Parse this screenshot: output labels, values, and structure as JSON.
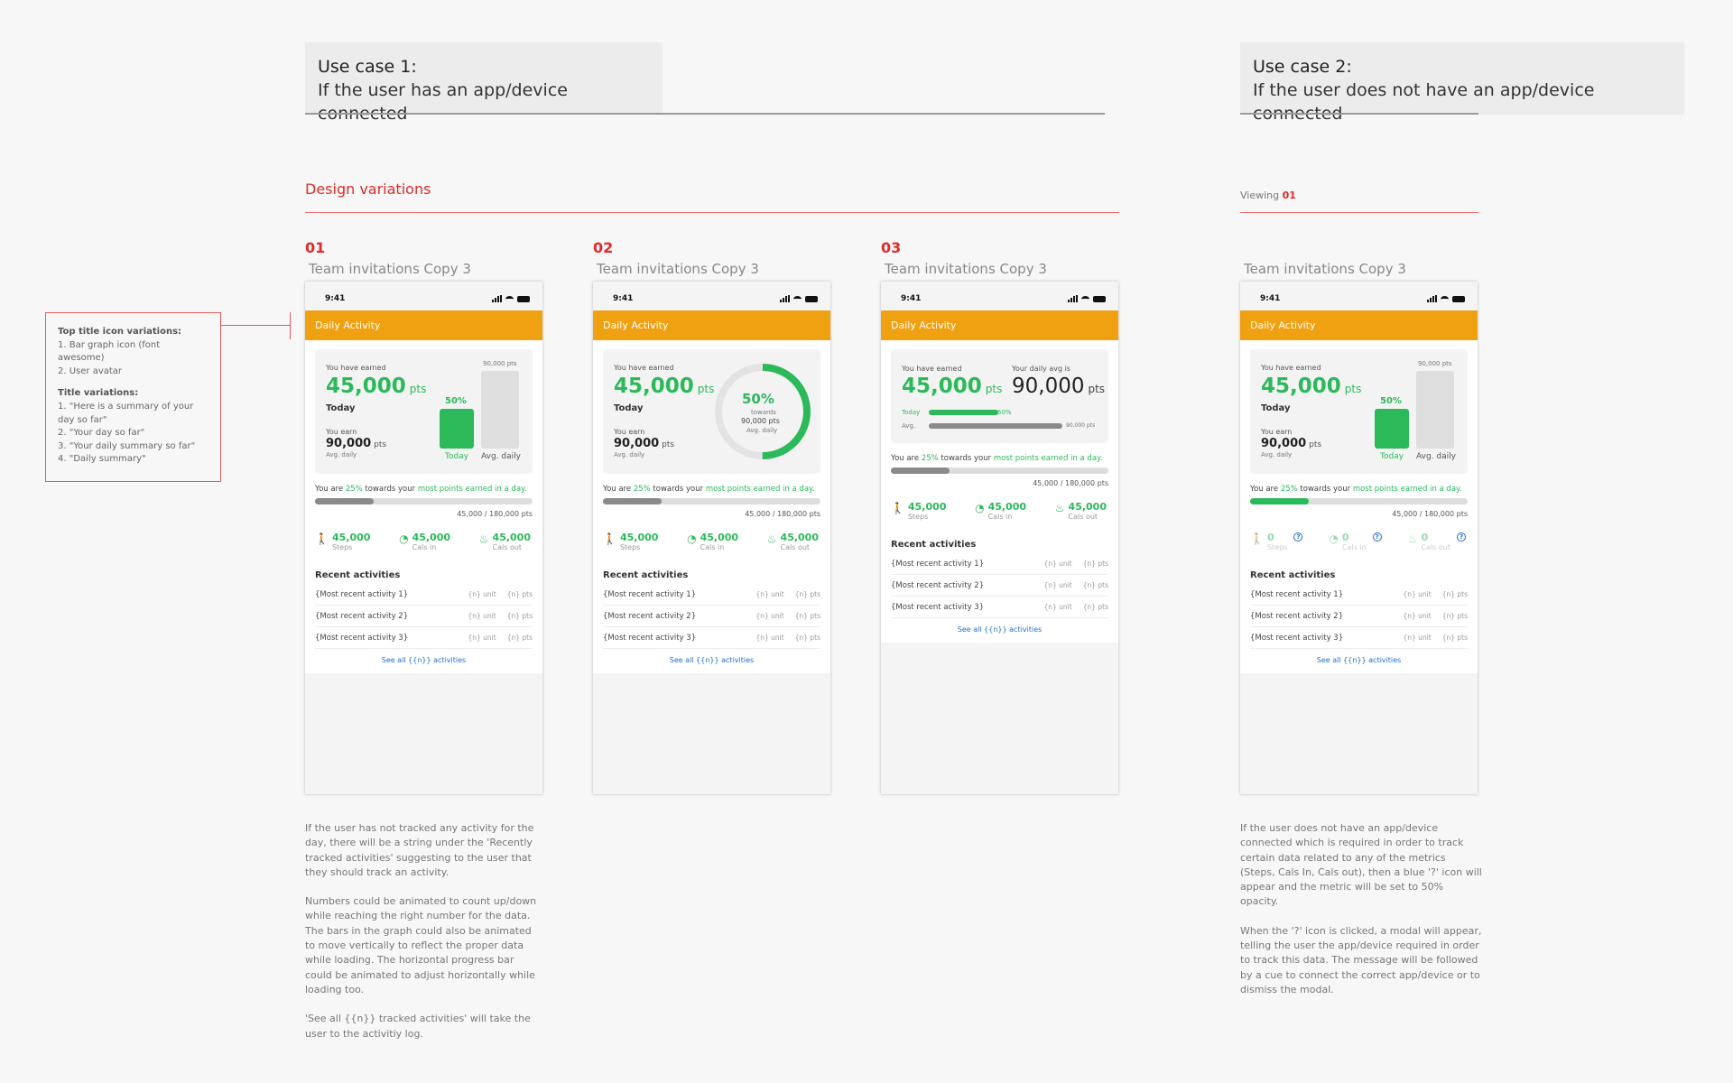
{
  "use_case_1": {
    "title": "Use case 1:",
    "subtitle": "If the user has an app/device connected"
  },
  "use_case_2": {
    "title": "Use case 2:",
    "subtitle": "If the user does not have an app/device connected"
  },
  "design_variations": "Design variations",
  "viewing": {
    "label": "Viewing",
    "value": "01"
  },
  "note": {
    "h1": "Top title icon variations:",
    "l1": "1. Bar graph icon (font awesome)",
    "l2": "2. User avatar",
    "h2": "Title variations:",
    "l3": "1. \"Here is a summary of your",
    "l4": "day so far\"",
    "l5": "2. \"Your day so far\"",
    "l6": "3. \"Your daily summary so far\"",
    "l7": "4. \"Daily summary\""
  },
  "screen": {
    "time": "9:41",
    "appbar": "Daily Activity",
    "you_have_earned": "You have earned",
    "earned_value": "45,000",
    "pts": "pts",
    "today": "Today",
    "you_earn": "You earn",
    "earn_value": "90,000",
    "avg_daily_small": "Avg. daily",
    "bar_top_label": "90,000 pts",
    "pct": "50%",
    "bar_today": "Today",
    "bar_avg": "Avg. daily",
    "goal_pre": "You are ",
    "goal_pct": "25%",
    "goal_mid": " towards your ",
    "goal_link": "most points earned in a day.",
    "goal_value": "45,000 / 180,000 pts",
    "goal_progress": 0.27,
    "steps_value": "45,000",
    "steps_label": "Steps",
    "calsin_value": "45,000",
    "calsin_label": "Cals in",
    "calsout_value": "45,000",
    "calsout_label": "Cals out",
    "zero_value": "0",
    "recent": "Recent activities",
    "activities": [
      {
        "name": "{Most recent activity 1}",
        "unit": "{n} unit",
        "pts": "{n} pts"
      },
      {
        "name": "{Most recent activity 2}",
        "unit": "{n} unit",
        "pts": "{n} pts"
      },
      {
        "name": "{Most recent activity 3}",
        "unit": "{n} unit",
        "pts": "{n} pts"
      }
    ],
    "see_all": "See all {{n}} activities",
    "ring_towards": "towards",
    "ring_value": "90,000 pts",
    "ring_progress": 0.5,
    "daily_avg_label": "Your daily avg is",
    "daily_avg_value": "90,000",
    "hbar_today": "Today",
    "hbar_avg": "Avg.",
    "hbar_today_progress": 0.5,
    "hbar_avg_value": "90,000 pts"
  },
  "variations": [
    {
      "num": "01",
      "title": "Team invitations Copy 3"
    },
    {
      "num": "02",
      "title": "Team invitations Copy 3"
    },
    {
      "num": "03",
      "title": "Team invitations Copy 3"
    },
    {
      "title": "Team invitations Copy 3"
    }
  ],
  "desc1": {
    "p1": "If the user has not tracked any activity for the day, there will be a string under the 'Recently tracked activities' suggesting to the user that they should track an activity.",
    "p2": "Numbers could be animated to count up/down while reaching the right number for the data. The bars in the graph could also be animated to move vertically to reflect the proper data while loading. The horizontal progress bar could be animated to adjust horizontally while loading too.",
    "p3": "'See all {{n}} tracked activities' will take the user to the activitiy log."
  },
  "desc2": {
    "p1": "If the user does not have an app/device connected which is required in order to track certain data related to any of the metrics (Steps, Cals In, Cals out), then a blue '?' icon will appear and the metric will be set to 50% opacity.",
    "p2": "When the '?' icon is clicked, a modal will appear, telling the user the app/device required in order to track this data. The message will be followed by a cue to connect the correct app/device or to dismiss the modal."
  },
  "colors": {
    "accent": "#f0a112",
    "green": "#2bb95a",
    "red": "#e02b2b",
    "link": "#1a6fd0"
  }
}
